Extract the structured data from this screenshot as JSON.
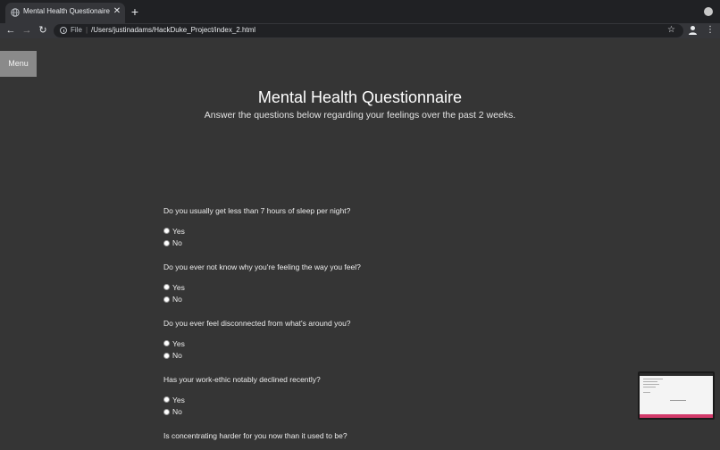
{
  "browser": {
    "tab_title": "Mental Health Questionaire",
    "url_scheme": "File",
    "url": "/Users/justinadams/HackDuke_Project/index_2.html",
    "icons": {
      "favicon": "globe-icon",
      "close": "close-icon",
      "new_tab": "plus-icon",
      "back": "back-arrow-icon",
      "forward": "forward-arrow-icon",
      "reload": "reload-icon",
      "info": "info-icon",
      "bookmark": "star-icon",
      "profile": "profile-icon",
      "menu": "kebab-menu-icon",
      "window": "window-control-icon"
    },
    "glyphs": {
      "close": "✕",
      "new_tab": "+",
      "back": "←",
      "forward": "→",
      "reload": "↻",
      "separator": "|",
      "star": "☆",
      "kebab": "⋮"
    }
  },
  "page": {
    "menu_label": "Menu",
    "title": "Mental Health Questionnaire",
    "subtitle": "Answer the questions below regarding your feelings over the past 2 weeks.",
    "questions": [
      {
        "text": "Do you usually get less than 7 hours of sleep per night?",
        "options": [
          "Yes",
          "No"
        ]
      },
      {
        "text": "Do you ever not know why you're feeling the way you feel?",
        "options": [
          "Yes",
          "No"
        ]
      },
      {
        "text": "Do you ever feel disconnected from what's around you?",
        "options": [
          "Yes",
          "No"
        ]
      },
      {
        "text": "Has your work-ethic notably declined recently?",
        "options": [
          "Yes",
          "No"
        ]
      },
      {
        "text": "Is concentrating harder for you now than it used to be?",
        "options": []
      }
    ]
  },
  "colors": {
    "page_background": "#353535",
    "menu_button": "#8a8a8a",
    "tabbar": "#202124",
    "thumbnail_footer": "#d23a6a"
  }
}
